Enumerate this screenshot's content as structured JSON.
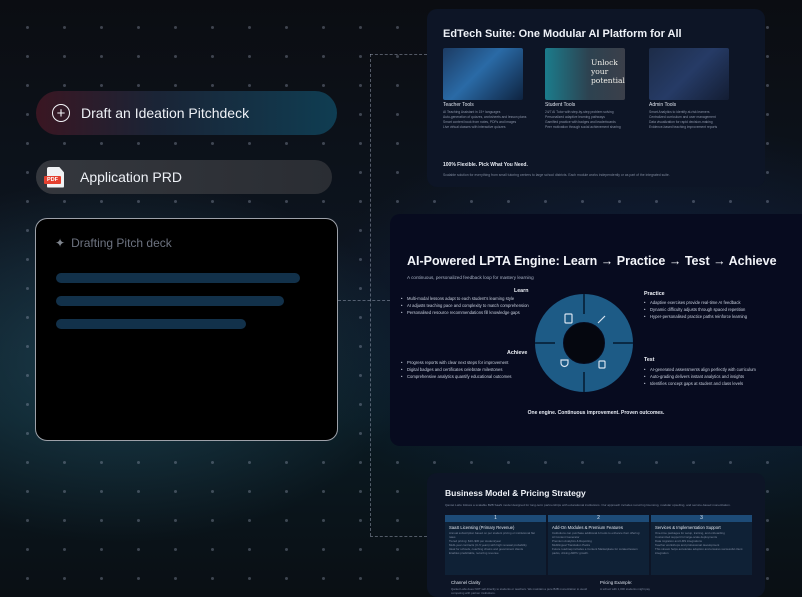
{
  "left": {
    "draft_action": {
      "label": "Draft an Ideation Pitchdeck",
      "icon": "plus-circle-icon"
    },
    "prd_action": {
      "label": "Application PRD",
      "icon": "pdf-file-icon",
      "icon_tag": "PDF"
    },
    "drafting_card": {
      "title": "Drafting Pitch deck",
      "icon": "sparkle-icon"
    }
  },
  "slides": {
    "edtech": {
      "title": "EdTech Suite: One Modular AI Platform for All",
      "image_caption": [
        "Unlock",
        "your",
        "potential"
      ],
      "columns": [
        {
          "heading": "Teacher Tools",
          "items": [
            "AI Teaching Assistant in 15+ languages",
            "Auto-generation of quizzes, worksheets and lesson plans",
            "Smart content book from notes, PDFs and images",
            "Live virtual classes with interactive quizzes"
          ]
        },
        {
          "heading": "Student Tools",
          "items": [
            "24/7 AI Tutor with step-by-step problem solving",
            "Personalized adaptive learning pathways",
            "Gamified practice with badges and leaderboards",
            "Peer motivation through social achievement sharing"
          ]
        },
        {
          "heading": "Admin Tools",
          "items": [
            "Smart Analytics to identify at-risk learners",
            "Centralized curriculum and user management",
            "Data visualization for rapid decision-making",
            "Evidence-based teaching improvement reports"
          ]
        }
      ],
      "footer_heading": "100% Flexible. Pick What You Need.",
      "footer_text": "Scalable solution for everything from small tutoring centers to large school districts. Each module works independently or as part of the integrated suite."
    },
    "lpta": {
      "title": "AI-Powered LPTA Engine: Learn → Practice → Test → Achieve",
      "subtitle": "A continuous, personalized feedback loop for mastery learning",
      "learn": {
        "heading": "Learn",
        "items": [
          "Multi-modal lessons adapt to each student's learning style",
          "AI adjusts teaching pace and complexity to match comprehension",
          "Personalised resource recommendations fill knowledge gaps"
        ]
      },
      "achieve": {
        "heading": "Achieve",
        "items": [
          "Progress reports with clear next steps for improvement",
          "Digital badges and certificates celebrate milestones",
          "Comprehensive analytics quantify educational outcomes"
        ]
      },
      "practice": {
        "heading": "Practice",
        "items": [
          "Adaptive exercises provide real-time AI feedback",
          "Dynamic difficulty adjusts through spaced repetition",
          "Hyper-personalised practice paths reinforce learning"
        ]
      },
      "test": {
        "heading": "Test",
        "items": [
          "AI-generated assessments align perfectly with curriculum",
          "Auto-grading delivers instant analytics and insights",
          "Identifies concept gaps at student and class levels"
        ]
      },
      "tagline": "One engine. Continuous improvement. Proven outcomes.",
      "ring_icons": [
        "book-icon",
        "pencil-icon",
        "trash-icon",
        "trophy-icon"
      ],
      "ring_color": "#1d5b86"
    },
    "pricing": {
      "title": "Business Model & Pricing Strategy",
      "description": "Qantet Labs follows a scalable B2B SaaS model designed for long-term partnerships with educational institutions. Our approach includes recurring licensing, modular upselling, and service-based monetization.",
      "columns": [
        {
          "number": "1",
          "heading": "SaaS Licensing (Primary Revenue)",
          "items": [
            "Annual subscription based on per student pricing or institutional flat rates",
            "Tiered pricing: $10–$30 per student/year",
            "Multi-year contracts (3–5 years) with high renewal probability",
            "Ideal for schools, coaching chains and government clients",
            "Enables predictable, recurring revenue"
          ]
        },
        {
          "number": "2",
          "heading": "Add-On Modules & Premium Features",
          "items": [
            "Institutions can purchase additional AI tools to enhance their offering:",
            "AI Content Generator",
            "Premium Analytics & Reporting",
            "Multilingual Translation Packs",
            "Future roadmap includes a Content Marketplace for curated lesson packs, driving ARPU growth."
          ]
        },
        {
          "number": "3",
          "heading": "Services & Implementation Support",
          "items": [
            "One-time packages for setup, training, and onboarding",
            "Customized support for large-scale deployments",
            "Data migration and LMS integrations",
            "Teacher workshops and professional development",
            "This stream helps accelerate adoption and ensures successful client integration"
          ]
        }
      ],
      "channel_heading": "Channel Clarity",
      "channel_text": "Qantet Labs does NOT sell directly to students or teachers. We maintain a pure B2B monetization to avoid competing with partner institutions.",
      "example_heading": "Pricing Example:",
      "example_text": "A school with 1,000 students might pay"
    }
  }
}
